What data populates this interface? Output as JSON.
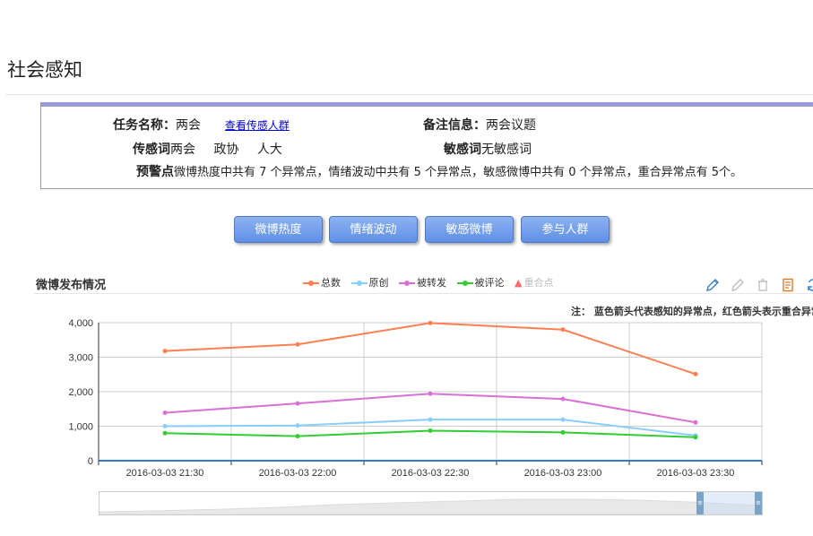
{
  "page": {
    "title": "社会感知"
  },
  "info": {
    "task_label": "任务名称：",
    "task_value": "两会",
    "view_link": "查看传感人群",
    "remark_label": "备注信息：",
    "remark_value": "两会议题",
    "sensor_label": "传感词",
    "sensor_words": [
      "两会",
      "政协",
      "人大"
    ],
    "sensitive_label": "敏感词",
    "sensitive_value": "无敏感词",
    "warning_label": "预警点",
    "warning_text": "微博热度中共有 7 个异常点，情绪波动中共有 5 个异常点，敏感微博中共有 0 个异常点，重合异常点有 5个。"
  },
  "tabs": [
    "微博热度",
    "情绪波动",
    "敏感微博",
    "参与人群"
  ],
  "chart": {
    "title": "微博发布情况",
    "note": "注：  蓝色箭头代表感知的异常点，红色箭头表示重合异常",
    "legend": [
      {
        "name": "总数",
        "color": "#ff7f50"
      },
      {
        "name": "原创",
        "color": "#87cefa"
      },
      {
        "name": "被转发",
        "color": "#da70d6"
      },
      {
        "name": "被评论",
        "color": "#32cd32"
      },
      {
        "name": "重合点",
        "color": "#ff6a6a"
      }
    ],
    "toolbox": [
      "pencil-icon",
      "eraser-icon",
      "clear-icon",
      "data-view-icon",
      "refresh-icon",
      "save-icon"
    ]
  },
  "chart_data": {
    "type": "line",
    "title": "微博发布情况",
    "x": [
      "2016-03-03 21:30",
      "2016-03-03 22:00",
      "2016-03-03 22:30",
      "2016-03-03 23:00",
      "2016-03-03 23:30"
    ],
    "y_ticks": [
      "0",
      "1,000",
      "2,000",
      "3,000",
      "4,000"
    ],
    "ylim": [
      0,
      4000
    ],
    "series": [
      {
        "name": "总数",
        "color": "#ff7f50",
        "values": [
          3180,
          3370,
          3990,
          3800,
          2510
        ]
      },
      {
        "name": "原创",
        "color": "#87cefa",
        "values": [
          1000,
          1020,
          1190,
          1190,
          730
        ]
      },
      {
        "name": "被转发",
        "color": "#da70d6",
        "values": [
          1390,
          1660,
          1940,
          1790,
          1110
        ]
      },
      {
        "name": "被评论",
        "color": "#32cd32",
        "values": [
          800,
          710,
          870,
          820,
          680
        ]
      }
    ],
    "legend_position": "top",
    "grid": true
  }
}
